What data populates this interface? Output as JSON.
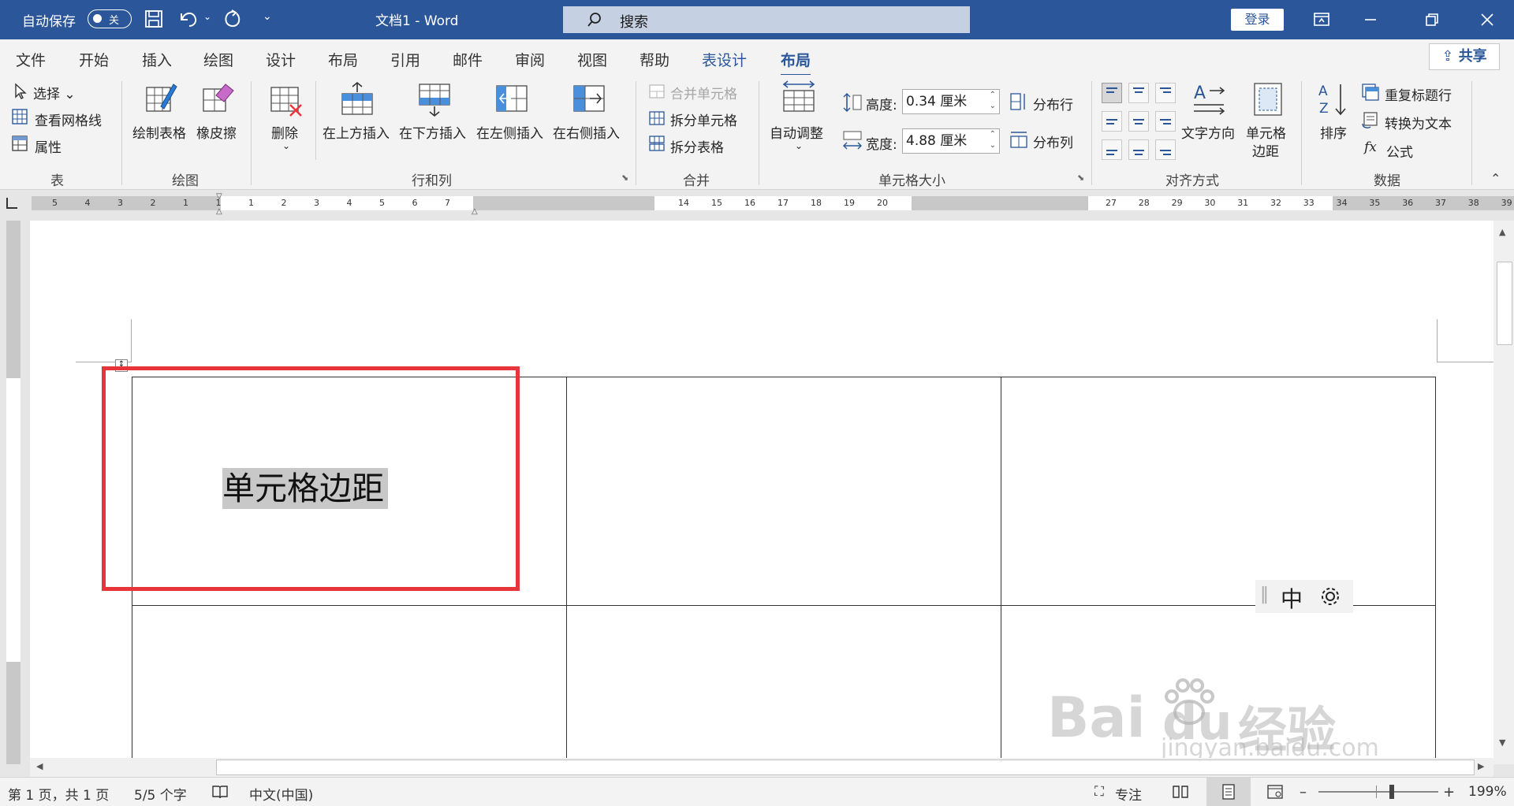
{
  "titlebar": {
    "autosave_label": "自动保存",
    "autosave_state": "关",
    "doc_title": "文档1  -  Word",
    "search_placeholder": "搜索",
    "signin_label": "登录"
  },
  "tabs": [
    {
      "label": "文件"
    },
    {
      "label": "开始"
    },
    {
      "label": "插入"
    },
    {
      "label": "绘图"
    },
    {
      "label": "设计"
    },
    {
      "label": "布局"
    },
    {
      "label": "引用"
    },
    {
      "label": "邮件"
    },
    {
      "label": "审阅"
    },
    {
      "label": "视图"
    },
    {
      "label": "帮助"
    },
    {
      "label": "表设计"
    },
    {
      "label": "布局"
    }
  ],
  "share_label": "共享",
  "ribbon": {
    "table_group": {
      "select": "选择",
      "gridlines": "查看网格线",
      "properties": "属性",
      "label": "表"
    },
    "draw_group": {
      "draw_table": "绘制表格",
      "eraser": "橡皮擦",
      "label": "绘图"
    },
    "rows_cols_group": {
      "delete": "删除",
      "insert_above": "在上方插入",
      "insert_below": "在下方插入",
      "insert_left": "在左侧插入",
      "insert_right": "在右侧插入",
      "label": "行和列"
    },
    "merge_group": {
      "merge_cells": "合并单元格",
      "split_cells": "拆分单元格",
      "split_table": "拆分表格",
      "label": "合并"
    },
    "cell_size_group": {
      "autofit": "自动调整",
      "height_label": "高度:",
      "height_value": "0.34 厘米",
      "width_label": "宽度:",
      "width_value": "4.88 厘米",
      "distribute_rows": "分布行",
      "distribute_cols": "分布列",
      "label": "单元格大小"
    },
    "alignment_group": {
      "text_direction": "文字方向",
      "cell_margins_line1": "单元格",
      "cell_margins_line2": "边距",
      "label": "对齐方式"
    },
    "data_group": {
      "sort": "排序",
      "repeat_header": "重复标题行",
      "convert_to_text": "转换为文本",
      "formula": "公式",
      "label": "数据"
    }
  },
  "ruler_numbers_left": [
    "5",
    "4",
    "3",
    "2",
    "1",
    "1",
    "1",
    "2",
    "3",
    "4",
    "5",
    "6",
    "7"
  ],
  "ruler_numbers_mid": [
    "14",
    "15",
    "16",
    "17",
    "18",
    "19",
    "20"
  ],
  "ruler_numbers_right": [
    "27",
    "28",
    "29",
    "30",
    "31",
    "32",
    "33",
    "34",
    "35",
    "36",
    "37",
    "38",
    "39"
  ],
  "document": {
    "cell_text": "单元格边距"
  },
  "ime": {
    "mode": "中"
  },
  "watermark": {
    "brand": "Bai",
    "brand2": "du",
    "cn": "经验",
    "url": "jingyan.baidu.com"
  },
  "status": {
    "page": "第 1 页，共 1 页",
    "words": "5/5 个字",
    "language": "中文(中国)",
    "focus": "专注",
    "zoom": "199%"
  }
}
